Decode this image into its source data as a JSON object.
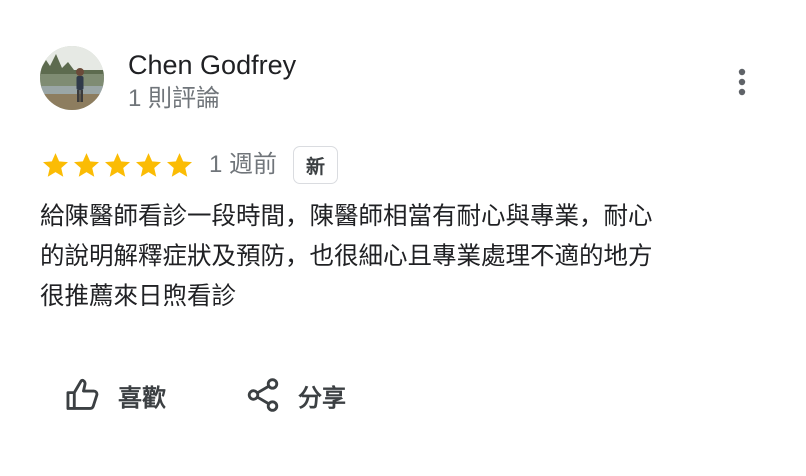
{
  "reviewer": {
    "name": "Chen Godfrey",
    "review_count": "1 則評論",
    "avatar": "reviewer-photo"
  },
  "more_menu": {
    "icon": "more-vert-icon"
  },
  "rating": {
    "stars": 5,
    "max_stars": 5,
    "star_color": "#fbbc04",
    "time_ago": "1 週前",
    "badge": "新"
  },
  "review": {
    "text": "給陳醫師看診一段時間，陳醫師相當有耐心與專業，耐心\n的說明解釋症狀及預防，也很細心且專業處理不適的地方\n很推薦來日煦看診"
  },
  "actions": {
    "like_label": "喜歡",
    "like_icon": "thumb-up-icon",
    "share_label": "分享",
    "share_icon": "share-icon"
  }
}
